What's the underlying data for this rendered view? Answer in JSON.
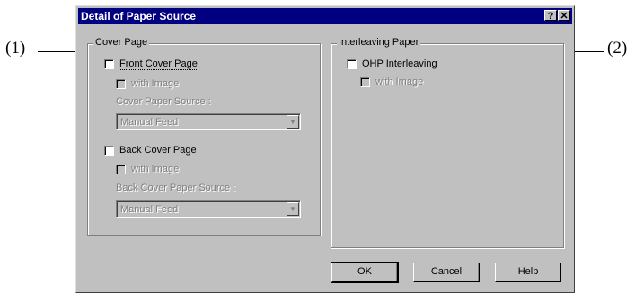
{
  "callouts": {
    "left": "(1)",
    "right": "(2)"
  },
  "window": {
    "title": "Detail of Paper Source",
    "help_glyph": "?",
    "close_glyph": "✕"
  },
  "cover_page": {
    "group_label": "Cover Page",
    "front": {
      "label": "Front Cover Page",
      "with_image": "with Image",
      "source_label": "Cover Paper Source :",
      "source_value": "Manual Feed"
    },
    "back": {
      "label": "Back Cover Page",
      "with_image": "with Image",
      "source_label": "Back Cover Paper Source :",
      "source_value": "Manual Feed"
    }
  },
  "interleaving": {
    "group_label": "Interleaving Paper",
    "ohp_label": "OHP Interleaving",
    "with_image": "with Image"
  },
  "buttons": {
    "ok": "OK",
    "cancel": "Cancel",
    "help": "Help"
  },
  "icons": {
    "dropdown": "chevron-down-icon"
  }
}
